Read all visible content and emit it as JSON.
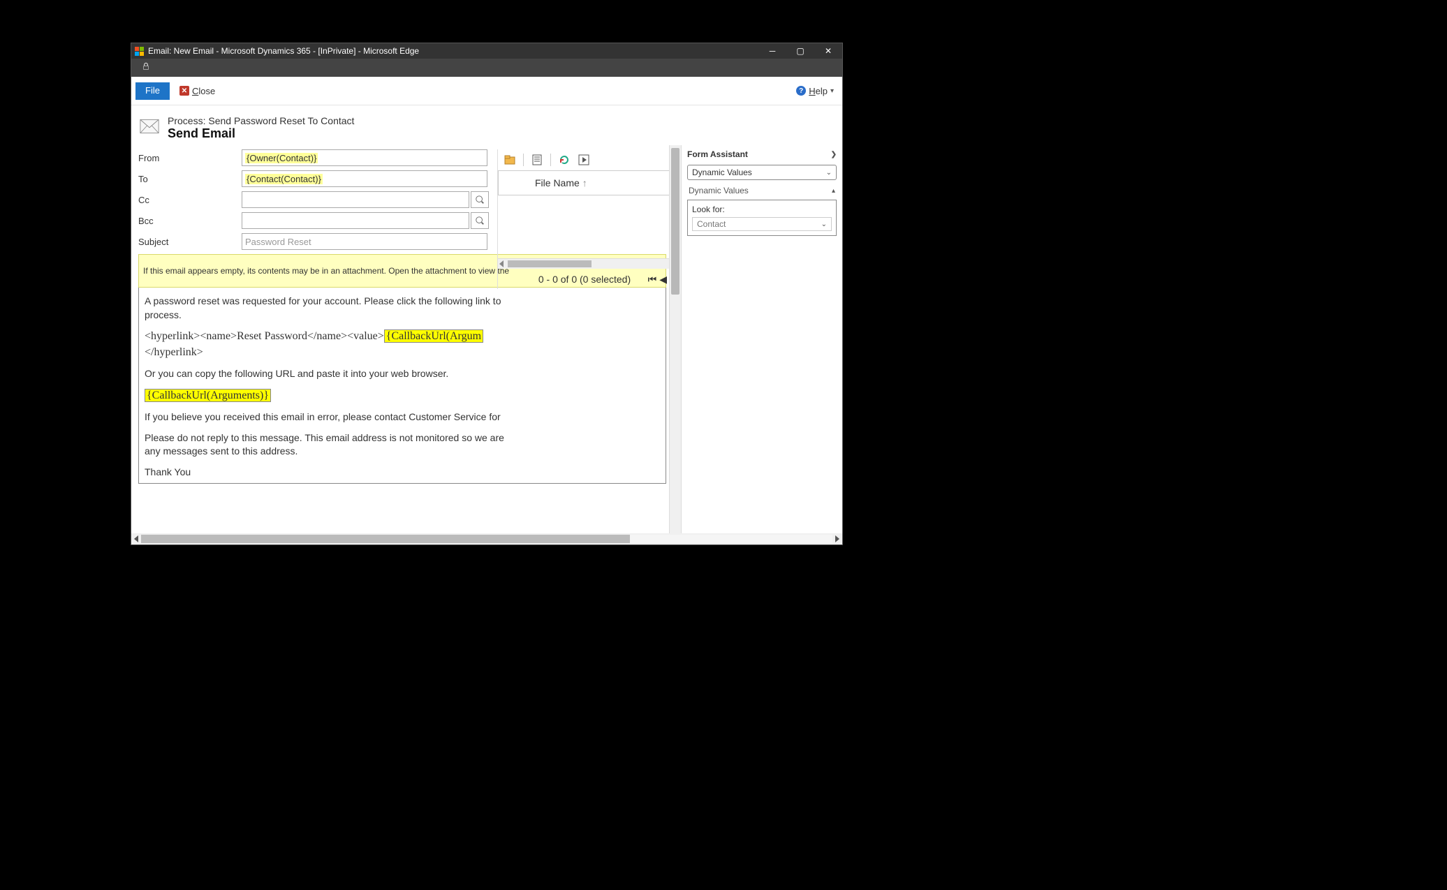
{
  "window": {
    "title": "Email: New Email - Microsoft Dynamics 365 - [InPrivate] - Microsoft Edge"
  },
  "commandbar": {
    "file": "File",
    "close": "Close",
    "help": "Help"
  },
  "header": {
    "process": "Process: Send Password Reset To Contact",
    "title": "Send Email"
  },
  "form": {
    "from_label": "From",
    "from_value": "{Owner(Contact)}",
    "to_label": "To",
    "to_value": "{Contact(Contact)}",
    "cc_label": "Cc",
    "bcc_label": "Bcc",
    "subject_label": "Subject",
    "subject_value": "Password Reset"
  },
  "attachments": {
    "column": "File Name",
    "status": "0 - 0 of 0 (0 selected)"
  },
  "assistant": {
    "title": "Form Assistant",
    "mode": "Dynamic Values",
    "section": "Dynamic Values",
    "lookfor_label": "Look for:",
    "lookfor_value": "Contact"
  },
  "notice": "If this email appears empty, its contents may be in an attachment. Open the attachment to view the",
  "body": {
    "p1": "A password reset was requested for your account. Please click the following link to",
    "p1b": "process.",
    "link_prefix": "<hyperlink><name>Reset Password</name><value>",
    "link_token": "{CallbackUrl(Argum",
    "link_suffix": "</hyperlink>",
    "p3": "Or you can copy the following URL and paste it into your web browser.",
    "token": "{CallbackUrl(Arguments)}",
    "p4": "If you believe you received this email in error, please contact Customer Service for",
    "p5": "Please do not reply to this message. This email address is not monitored so we are",
    "p5b": "any messages sent to this address.",
    "p6": "Thank You"
  }
}
